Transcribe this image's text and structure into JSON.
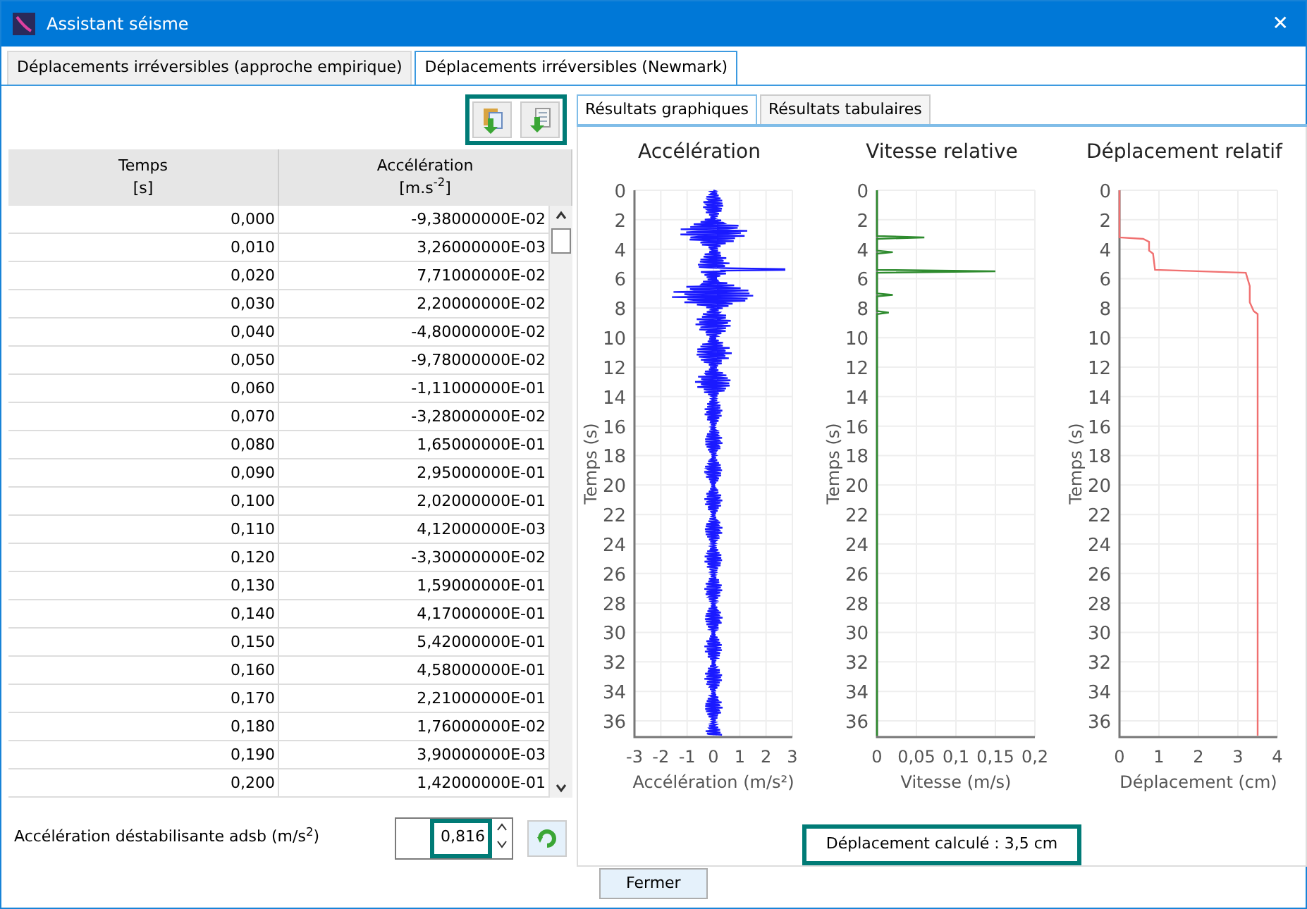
{
  "window": {
    "title": "Assistant séisme",
    "close": "✕"
  },
  "tabs": [
    {
      "label": "Déplacements irréversibles (approche empirique)",
      "selected": false
    },
    {
      "label": "Déplacements irréversibles (Newmark)",
      "selected": true
    }
  ],
  "table": {
    "columns": [
      {
        "label": "Temps",
        "unit": "[s]"
      },
      {
        "label": "Accélération",
        "unit": "[m.s$^{-2}$]"
      }
    ],
    "rows": [
      [
        "0,000",
        "-9,38000000E-02"
      ],
      [
        "0,010",
        "3,26000000E-03"
      ],
      [
        "0,020",
        "7,71000000E-02"
      ],
      [
        "0,030",
        "2,20000000E-02"
      ],
      [
        "0,040",
        "-4,80000000E-02"
      ],
      [
        "0,050",
        "-9,78000000E-02"
      ],
      [
        "0,060",
        "-1,11000000E-01"
      ],
      [
        "0,070",
        "-3,28000000E-02"
      ],
      [
        "0,080",
        "1,65000000E-01"
      ],
      [
        "0,090",
        "2,95000000E-01"
      ],
      [
        "0,100",
        "2,02000000E-01"
      ],
      [
        "0,110",
        "4,12000000E-03"
      ],
      [
        "0,120",
        "-3,30000000E-02"
      ],
      [
        "0,130",
        "1,59000000E-01"
      ],
      [
        "0,140",
        "4,17000000E-01"
      ],
      [
        "0,150",
        "5,42000000E-01"
      ],
      [
        "0,160",
        "4,58000000E-01"
      ],
      [
        "0,170",
        "2,21000000E-01"
      ],
      [
        "0,180",
        "1,76000000E-02"
      ],
      [
        "0,190",
        "3,90000000E-03"
      ],
      [
        "0,200",
        "1,42000000E-01"
      ]
    ]
  },
  "field": {
    "label": "Accélération déstabilisante adsb (m/s$^{2}$)",
    "value": "0,816"
  },
  "subtabs": [
    {
      "label": "Résultats graphiques",
      "selected": true
    },
    {
      "label": "Résultats tabulaires",
      "selected": false
    }
  ],
  "charts": [
    {
      "kind": "acceleration",
      "title": "Accélération",
      "ylabel": "Temps (s)",
      "xlabel": "Accélération (m/s²)",
      "xticks": [
        "-3",
        "-2",
        "-1",
        "0",
        "1",
        "2",
        "3"
      ],
      "yticks": [
        "0",
        "2",
        "4",
        "6",
        "8",
        "10",
        "12",
        "14",
        "16",
        "18",
        "20",
        "22",
        "24",
        "26",
        "28",
        "30",
        "32",
        "34",
        "36"
      ]
    },
    {
      "kind": "velocity",
      "title": "Vitesse relative",
      "ylabel": "Temps (s)",
      "xlabel": "Vitesse (m/s)",
      "xticks": [
        "0",
        "0,05",
        "0,1",
        "0,15",
        "0,2"
      ],
      "yticks": [
        "0",
        "2",
        "4",
        "6",
        "8",
        "10",
        "12",
        "14",
        "16",
        "18",
        "20",
        "22",
        "24",
        "26",
        "28",
        "30",
        "32",
        "34",
        "36"
      ]
    },
    {
      "kind": "displacement",
      "title": "Déplacement relatif",
      "ylabel": "Temps (s)",
      "xlabel": "Déplacement (cm)",
      "xticks": [
        "0",
        "1",
        "2",
        "3",
        "4"
      ],
      "yticks": [
        "0",
        "2",
        "4",
        "6",
        "8",
        "10",
        "12",
        "14",
        "16",
        "18",
        "20",
        "22",
        "24",
        "26",
        "28",
        "30",
        "32",
        "34",
        "36"
      ]
    }
  ],
  "result": "Déplacement calculé : 3,5 cm",
  "close_button": "Fermer"
}
